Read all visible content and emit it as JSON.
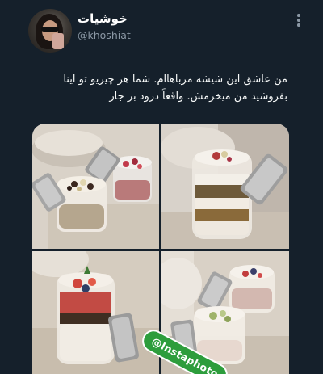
{
  "user": {
    "display_name": "خوشیات",
    "handle": "@khoshiat"
  },
  "tweet": {
    "lines": [
      "من عاشق این شیشه مرباهاام. شما هر چیزیو تو اینا",
      "بفروشید من میخرمش. واقعاً درود بر جار"
    ]
  },
  "media": {
    "watermark": "@Instaphoto",
    "photo_count": 4
  },
  "icons": {
    "more": "more-vertical-icon"
  }
}
